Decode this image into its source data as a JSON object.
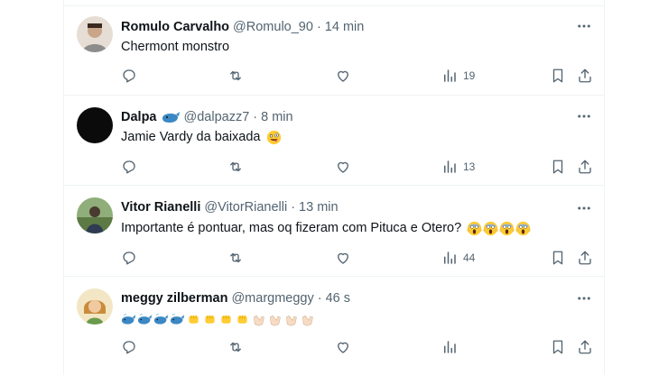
{
  "tweets": [
    {
      "name": "Romulo Carvalho",
      "handle": "@Romulo_90",
      "separator": "·",
      "time": "14 min",
      "text": "Chermont monstro",
      "views": "19",
      "avatar_color": "#d9cfc6",
      "emoji": []
    },
    {
      "name": "Dalpa",
      "handle": "@dalpazz7",
      "separator": "·",
      "time": "8 min",
      "text": "Jamie Vardy da baixada",
      "views": "13",
      "avatar_color": "#111111",
      "badge": "whale-emoji",
      "emoji": [
        "zany-face"
      ]
    },
    {
      "name": "Vitor Rianelli",
      "handle": "@VitorRianelli",
      "separator": "·",
      "time": "13 min",
      "text": "Importante é pontuar, mas oq fizeram com Pituca e Otero?",
      "views": "44",
      "avatar_color": "#6f8a5a",
      "emoji": [
        "scream-face",
        "scream-face",
        "scream-face",
        "scream-face"
      ]
    },
    {
      "name": "meggy zilberman",
      "handle": "@margmeggy",
      "separator": "·",
      "time": "46 s",
      "text": "",
      "views": "",
      "avatar_color": "#e9d8b0",
      "emoji": [
        "whale",
        "whale",
        "whale",
        "whale",
        "fist",
        "fist",
        "fist",
        "fist",
        "clap",
        "clap",
        "clap",
        "clap"
      ]
    }
  ],
  "icons": {
    "more": "more-horizontal-icon",
    "reply": "reply-icon",
    "retweet": "retweet-icon",
    "like": "like-icon",
    "views": "views-icon",
    "bookmark": "bookmark-icon",
    "share": "share-icon"
  },
  "colors": {
    "icon_gray": "#536471",
    "text": "#0f1419",
    "divider": "#eff3f4"
  }
}
